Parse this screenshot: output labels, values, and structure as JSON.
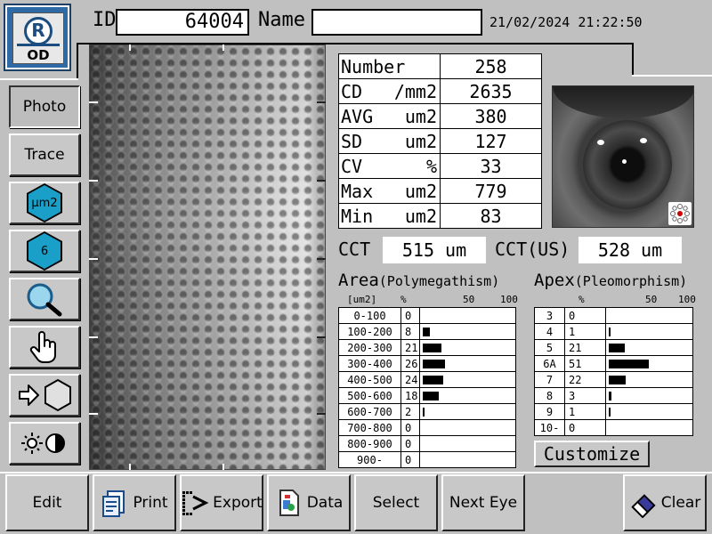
{
  "header": {
    "eye_side": "OD",
    "eye_logo_letter": "R",
    "id_label": "ID",
    "id_value": "64004",
    "name_label": "Name",
    "name_value": "",
    "datetime": "21/02/2024 21:22:50"
  },
  "tools": [
    {
      "label": "Photo",
      "icon": "none",
      "pressed": true
    },
    {
      "label": "Trace",
      "icon": "none",
      "pressed": false
    },
    {
      "label": "μm2",
      "icon": "hexagon-area-icon"
    },
    {
      "label": "6",
      "icon": "hexagon-apex-icon"
    },
    {
      "label": "",
      "icon": "magnifier-icon"
    },
    {
      "label": "",
      "icon": "hand-pointer-icon"
    },
    {
      "label": "",
      "icon": "arrow-hexagon-icon"
    },
    {
      "label": "",
      "icon": "brightness-contrast-icon"
    }
  ],
  "stats": [
    {
      "name": "Number",
      "unit": "",
      "value": "258"
    },
    {
      "name": "CD",
      "unit": "/mm2",
      "value": "2635"
    },
    {
      "name": "AVG",
      "unit": "um2",
      "value": "380"
    },
    {
      "name": "SD",
      "unit": "um2",
      "value": "127"
    },
    {
      "name": "CV",
      "unit": "%",
      "value": "33"
    },
    {
      "name": "Max",
      "unit": "um2",
      "value": "779"
    },
    {
      "name": "Min",
      "unit": "um2",
      "value": "83"
    }
  ],
  "cct": {
    "label": "CCT",
    "value": "515 um",
    "us_label": "CCT(US)",
    "us_value": "528 um"
  },
  "area_hist": {
    "title": "Area",
    "subtitle": "(Polymegathism)",
    "col_unit": "[um2]",
    "col_pct": "%",
    "scale_50": "50",
    "scale_100": "100",
    "rows": [
      {
        "range": "0-100",
        "pct": 0
      },
      {
        "range": "100-200",
        "pct": 8
      },
      {
        "range": "200-300",
        "pct": 21
      },
      {
        "range": "300-400",
        "pct": 26
      },
      {
        "range": "400-500",
        "pct": 24
      },
      {
        "range": "500-600",
        "pct": 18
      },
      {
        "range": "600-700",
        "pct": 2
      },
      {
        "range": "700-800",
        "pct": 0
      },
      {
        "range": "800-900",
        "pct": 0
      },
      {
        "range": "900-",
        "pct": 0
      }
    ]
  },
  "apex_hist": {
    "title": "Apex",
    "subtitle": "(Pleomorphism)",
    "col_pct": "%",
    "scale_50": "50",
    "scale_100": "100",
    "rows": [
      {
        "apex": "3",
        "pct": 0
      },
      {
        "apex": "4",
        "pct": 1
      },
      {
        "apex": "5",
        "pct": 21
      },
      {
        "apex": "6A",
        "pct": 51
      },
      {
        "apex": "7",
        "pct": 22
      },
      {
        "apex": "8",
        "pct": 3
      },
      {
        "apex": "9",
        "pct": 1
      },
      {
        "apex": "10-",
        "pct": 0
      }
    ]
  },
  "customize_label": "Customize",
  "bottom": {
    "edit": "Edit",
    "print": "Print",
    "export": "Export",
    "data": "Data",
    "select": "Select",
    "next_eye": "Next Eye",
    "clear": "Clear"
  },
  "colors": {
    "badge_blue": "#2d6aa6",
    "hex_cyan": "#1aa0c8",
    "background": "#c0c0c0"
  }
}
